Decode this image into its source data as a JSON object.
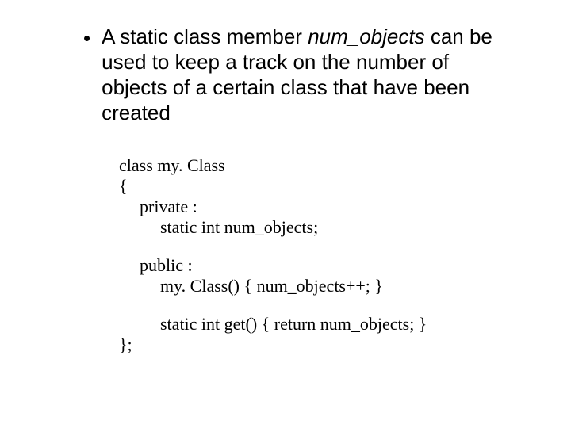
{
  "bullet": {
    "pre": "A static class member ",
    "var": "num_objects",
    "post": " can be used to keep a track on the number of objects of a certain class that have been created"
  },
  "code": {
    "l1": "class my. Class",
    "l2": "{",
    "l3": "private :",
    "l4": "static int num_objects;",
    "l5": "public :",
    "l6": "my. Class() { num_objects++; }",
    "l7": "static int get() { return num_objects; }",
    "l8": "};"
  }
}
